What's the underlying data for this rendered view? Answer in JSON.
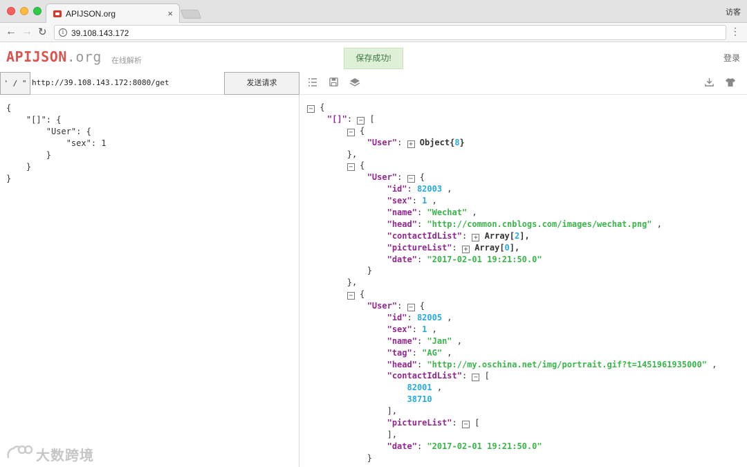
{
  "browser": {
    "tab_title": "APIJSON.org",
    "tab_close": "×",
    "profile": "访客",
    "url": "39.108.143.172",
    "info_glyph": "i",
    "back_glyph": "←",
    "forward_glyph": "→",
    "reload_glyph": "↻",
    "menu_glyph": "⋮"
  },
  "header": {
    "logo_main": "APIJSON",
    "logo_suffix": ".org",
    "logo_sub": "在线解析",
    "toast": "保存成功!",
    "login": "登录"
  },
  "request": {
    "quote_label": "' / \"",
    "url": "http://39.108.143.172:8080/get",
    "send_label": "发送请求",
    "body": "{\n    \"[]\": {\n        \"User\": {\n            \"sex\": 1\n        }\n    }\n}"
  },
  "toolbar": {
    "icons": [
      "sort-icon",
      "save-icon",
      "layers-icon",
      "download-icon",
      "shirt-icon"
    ]
  },
  "response": {
    "lines": [
      [
        {
          "t": "tg",
          "v": "−"
        },
        {
          "t": "c",
          "v": " {"
        }
      ],
      [
        {
          "t": "i",
          "v": "    "
        },
        {
          "t": "k",
          "v": "\"[]\""
        },
        {
          "t": "c",
          "v": ": "
        },
        {
          "t": "tg",
          "v": "−"
        },
        {
          "t": "c",
          "v": " ["
        }
      ],
      [
        {
          "t": "i",
          "v": "        "
        },
        {
          "t": "tg",
          "v": "−"
        },
        {
          "t": "c",
          "v": " {"
        }
      ],
      [
        {
          "t": "i",
          "v": "            "
        },
        {
          "t": "k",
          "v": "\"User\""
        },
        {
          "t": "c",
          "v": ": "
        },
        {
          "t": "tg",
          "v": "+"
        },
        {
          "t": "b",
          "v": " Object{"
        },
        {
          "t": "n",
          "v": "8"
        },
        {
          "t": "b",
          "v": "}"
        }
      ],
      [
        {
          "t": "i",
          "v": "        "
        },
        {
          "t": "c",
          "v": "},"
        }
      ],
      [
        {
          "t": "i",
          "v": "        "
        },
        {
          "t": "tg",
          "v": "−"
        },
        {
          "t": "c",
          "v": " {"
        }
      ],
      [
        {
          "t": "i",
          "v": "            "
        },
        {
          "t": "k",
          "v": "\"User\""
        },
        {
          "t": "c",
          "v": ": "
        },
        {
          "t": "tg",
          "v": "−"
        },
        {
          "t": "c",
          "v": " {"
        }
      ],
      [
        {
          "t": "i",
          "v": "                "
        },
        {
          "t": "k",
          "v": "\"id\""
        },
        {
          "t": "c",
          "v": ": "
        },
        {
          "t": "n",
          "v": "82003"
        },
        {
          "t": "c",
          "v": " ,"
        }
      ],
      [
        {
          "t": "i",
          "v": "                "
        },
        {
          "t": "k",
          "v": "\"sex\""
        },
        {
          "t": "c",
          "v": ": "
        },
        {
          "t": "n",
          "v": "1"
        },
        {
          "t": "c",
          "v": " ,"
        }
      ],
      [
        {
          "t": "i",
          "v": "                "
        },
        {
          "t": "k",
          "v": "\"name\""
        },
        {
          "t": "c",
          "v": ": "
        },
        {
          "t": "s",
          "v": "\"Wechat\""
        },
        {
          "t": "c",
          "v": " ,"
        }
      ],
      [
        {
          "t": "i",
          "v": "                "
        },
        {
          "t": "k",
          "v": "\"head\""
        },
        {
          "t": "c",
          "v": ": "
        },
        {
          "t": "s",
          "v": "\"http://common.cnblogs.com/images/wechat.png\""
        },
        {
          "t": "c",
          "v": " ,"
        }
      ],
      [
        {
          "t": "i",
          "v": "                "
        },
        {
          "t": "k",
          "v": "\"contactIdList\""
        },
        {
          "t": "c",
          "v": ": "
        },
        {
          "t": "tg",
          "v": "+"
        },
        {
          "t": "b",
          "v": " Array["
        },
        {
          "t": "n",
          "v": "2"
        },
        {
          "t": "b",
          "v": "],"
        }
      ],
      [
        {
          "t": "i",
          "v": "                "
        },
        {
          "t": "k",
          "v": "\"pictureList\""
        },
        {
          "t": "c",
          "v": ": "
        },
        {
          "t": "tg",
          "v": "+"
        },
        {
          "t": "b",
          "v": " Array["
        },
        {
          "t": "n",
          "v": "0"
        },
        {
          "t": "b",
          "v": "],"
        }
      ],
      [
        {
          "t": "i",
          "v": "                "
        },
        {
          "t": "k",
          "v": "\"date\""
        },
        {
          "t": "c",
          "v": ": "
        },
        {
          "t": "s",
          "v": "\"2017-02-01 19:21:50.0\""
        }
      ],
      [
        {
          "t": "i",
          "v": "            "
        },
        {
          "t": "c",
          "v": "}"
        }
      ],
      [
        {
          "t": "i",
          "v": "        "
        },
        {
          "t": "c",
          "v": "},"
        }
      ],
      [
        {
          "t": "i",
          "v": "        "
        },
        {
          "t": "tg",
          "v": "−"
        },
        {
          "t": "c",
          "v": " {"
        }
      ],
      [
        {
          "t": "i",
          "v": "            "
        },
        {
          "t": "k",
          "v": "\"User\""
        },
        {
          "t": "c",
          "v": ": "
        },
        {
          "t": "tg",
          "v": "−"
        },
        {
          "t": "c",
          "v": " {"
        }
      ],
      [
        {
          "t": "i",
          "v": "                "
        },
        {
          "t": "k",
          "v": "\"id\""
        },
        {
          "t": "c",
          "v": ": "
        },
        {
          "t": "n",
          "v": "82005"
        },
        {
          "t": "c",
          "v": " ,"
        }
      ],
      [
        {
          "t": "i",
          "v": "                "
        },
        {
          "t": "k",
          "v": "\"sex\""
        },
        {
          "t": "c",
          "v": ": "
        },
        {
          "t": "n",
          "v": "1"
        },
        {
          "t": "c",
          "v": " ,"
        }
      ],
      [
        {
          "t": "i",
          "v": "                "
        },
        {
          "t": "k",
          "v": "\"name\""
        },
        {
          "t": "c",
          "v": ": "
        },
        {
          "t": "s",
          "v": "\"Jan\""
        },
        {
          "t": "c",
          "v": " ,"
        }
      ],
      [
        {
          "t": "i",
          "v": "                "
        },
        {
          "t": "k",
          "v": "\"tag\""
        },
        {
          "t": "c",
          "v": ": "
        },
        {
          "t": "s",
          "v": "\"AG\""
        },
        {
          "t": "c",
          "v": " ,"
        }
      ],
      [
        {
          "t": "i",
          "v": "                "
        },
        {
          "t": "k",
          "v": "\"head\""
        },
        {
          "t": "c",
          "v": ": "
        },
        {
          "t": "s",
          "v": "\"http://my.oschina.net/img/portrait.gif?t=1451961935000\""
        },
        {
          "t": "c",
          "v": " ,"
        }
      ],
      [
        {
          "t": "i",
          "v": "                "
        },
        {
          "t": "k",
          "v": "\"contactIdList\""
        },
        {
          "t": "c",
          "v": ": "
        },
        {
          "t": "tg",
          "v": "−"
        },
        {
          "t": "c",
          "v": " ["
        }
      ],
      [
        {
          "t": "i",
          "v": "                    "
        },
        {
          "t": "n",
          "v": "82001"
        },
        {
          "t": "c",
          "v": " ,"
        }
      ],
      [
        {
          "t": "i",
          "v": "                    "
        },
        {
          "t": "n",
          "v": "38710"
        }
      ],
      [
        {
          "t": "i",
          "v": "                "
        },
        {
          "t": "c",
          "v": "],"
        }
      ],
      [
        {
          "t": "i",
          "v": "                "
        },
        {
          "t": "k",
          "v": "\"pictureList\""
        },
        {
          "t": "c",
          "v": ": "
        },
        {
          "t": "tg",
          "v": "−"
        },
        {
          "t": "c",
          "v": " ["
        }
      ],
      [
        {
          "t": "i",
          "v": "                "
        },
        {
          "t": "c",
          "v": "],"
        }
      ],
      [
        {
          "t": "i",
          "v": "                "
        },
        {
          "t": "k",
          "v": "\"date\""
        },
        {
          "t": "c",
          "v": ": "
        },
        {
          "t": "s",
          "v": "\"2017-02-01 19:21:50.0\""
        }
      ],
      [
        {
          "t": "i",
          "v": "            "
        },
        {
          "t": "c",
          "v": "}"
        }
      ]
    ]
  },
  "watermark": {
    "text": "大数跨境"
  },
  "colors": {
    "key": "#92278f",
    "string": "#3ab54a",
    "number": "#25aae1",
    "logo": "#d9534f",
    "toast_bg": "#dff0d8"
  }
}
